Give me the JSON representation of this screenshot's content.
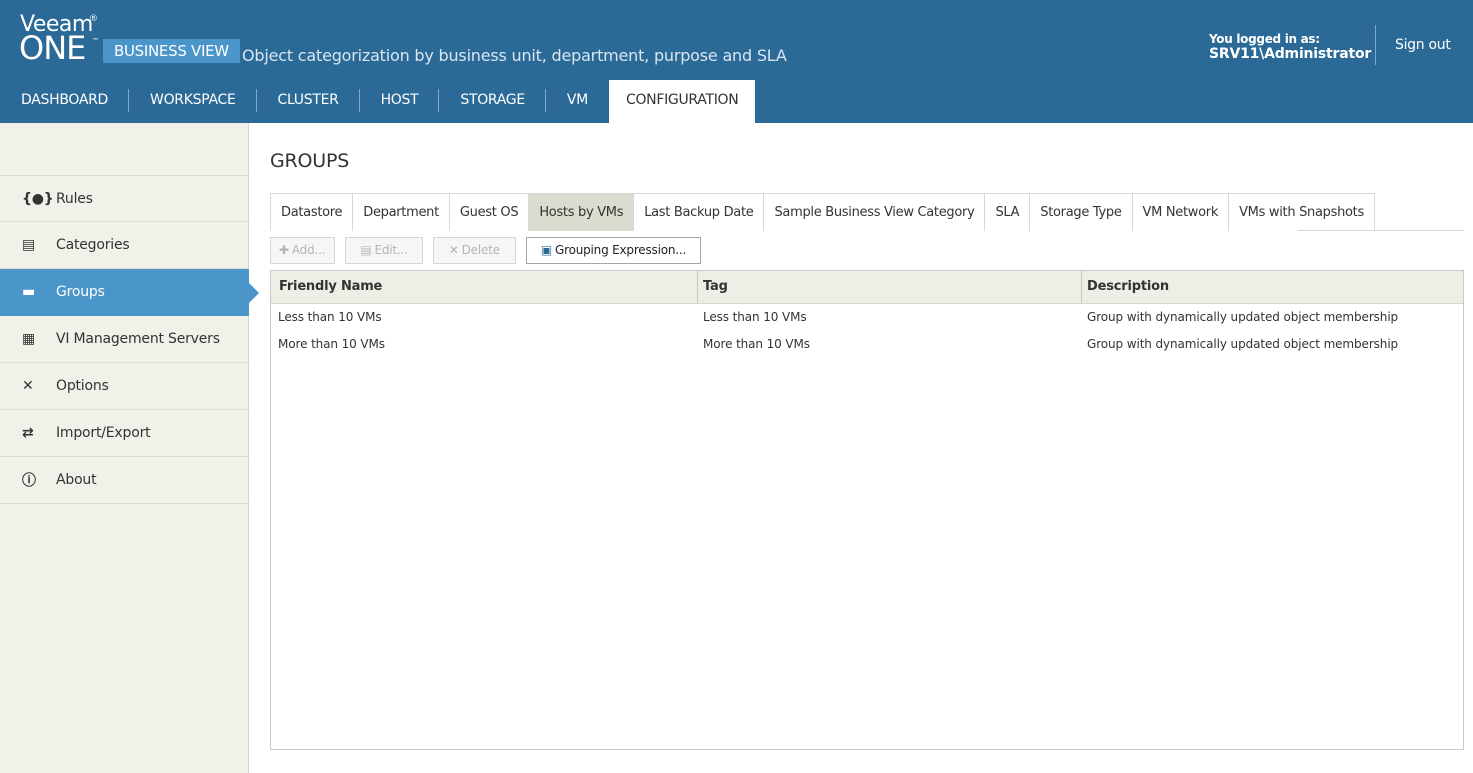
{
  "header": {
    "brand_veeam": "Veeam",
    "brand_reg": "®",
    "brand_one": "ONE",
    "brand_tm": "™",
    "product": "BUSINESS VIEW",
    "tagline": "Object categorization by business unit, department, purpose and SLA",
    "login_label": "You logged in as:",
    "login_user": "SRV11\\Administrator",
    "signout_label": "Sign out"
  },
  "nav": {
    "items": [
      {
        "label": "DASHBOARD"
      },
      {
        "label": "WORKSPACE"
      },
      {
        "label": "CLUSTER"
      },
      {
        "label": "HOST"
      },
      {
        "label": "STORAGE"
      },
      {
        "label": "VM"
      },
      {
        "label": "CONFIGURATION",
        "active": true
      }
    ]
  },
  "sidebar": {
    "items": [
      {
        "label": "Rules",
        "icon": "braces-icon",
        "glyph": "{●}"
      },
      {
        "label": "Categories",
        "icon": "inbox-icon",
        "glyph": "▤"
      },
      {
        "label": "Groups",
        "icon": "folder-icon",
        "glyph": "▬",
        "active": true
      },
      {
        "label": "VI Management Servers",
        "icon": "servers-icon",
        "glyph": "▦"
      },
      {
        "label": "Options",
        "icon": "tools-icon",
        "glyph": "✕"
      },
      {
        "label": "Import/Export",
        "icon": "import-export-icon",
        "glyph": "⇄"
      },
      {
        "label": "About",
        "icon": "info-icon",
        "glyph": "ⓘ"
      }
    ]
  },
  "main": {
    "title": "GROUPS",
    "tabs": [
      {
        "label": "Datastore"
      },
      {
        "label": "Department"
      },
      {
        "label": "Guest OS"
      },
      {
        "label": "Hosts by VMs",
        "active": true
      },
      {
        "label": "Last Backup Date"
      },
      {
        "label": "Sample Business View Category"
      },
      {
        "label": "SLA"
      },
      {
        "label": "Storage Type"
      },
      {
        "label": "VM Network"
      },
      {
        "label": "VMs with Snapshots"
      }
    ],
    "toolbar": {
      "add_label": "Add...",
      "edit_label": "Edit...",
      "delete_label": "Delete",
      "grouping_label": "Grouping Expression..."
    },
    "grid": {
      "columns": [
        "Friendly Name",
        "Tag",
        "Description"
      ],
      "rows": [
        {
          "name": "Less than 10 VMs",
          "tag": "Less than 10 VMs",
          "description": "Group with dynamically updated object membership"
        },
        {
          "name": "More than 10 VMs",
          "tag": "More than 10 VMs",
          "description": "Group with dynamically updated object membership"
        }
      ]
    }
  },
  "colors": {
    "header_bg": "#2b6a96",
    "accent": "#4a95c9",
    "sidebar_bg": "#f1f0e9"
  }
}
